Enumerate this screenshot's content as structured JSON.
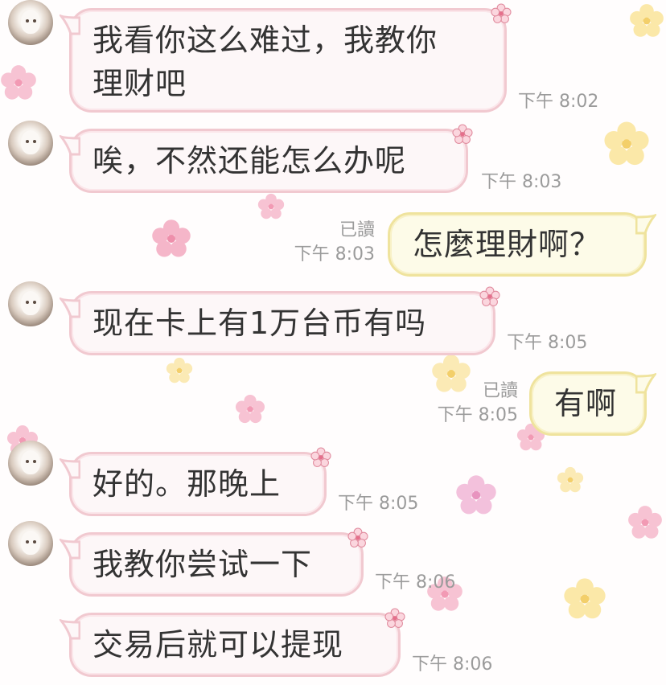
{
  "messages": [
    {
      "side": "in",
      "lines": [
        "我看你这么难过，我教你",
        "理财吧"
      ],
      "time": "下午 8:02"
    },
    {
      "side": "in",
      "lines": [
        "唉，不然还能怎么办呢"
      ],
      "time": "下午 8:03"
    },
    {
      "side": "out",
      "lines": [
        "怎麼理財啊？"
      ],
      "read": "已讀",
      "time": "下午 8:03"
    },
    {
      "side": "in",
      "lines": [
        "现在卡上有1万台币有吗"
      ],
      "time": "下午 8:05"
    },
    {
      "side": "out",
      "lines": [
        "有啊"
      ],
      "read": "已讀",
      "time": "下午 8:05"
    },
    {
      "side": "in",
      "lines": [
        "好的。那晚上"
      ],
      "time": "下午 8:05"
    },
    {
      "side": "in",
      "lines": [
        "我教你尝试一下"
      ],
      "time": "下午 8:06"
    },
    {
      "side": "in",
      "lines": [
        "交易后就可以提现"
      ],
      "time": "下午 8:06"
    }
  ],
  "icons": {
    "avatar": "cat-avatar-icon",
    "bubble_corner": "sakura-flower-icon"
  },
  "colors": {
    "incoming_border": "#f1c9d0",
    "outgoing_border": "#efe39d",
    "text": "#333333",
    "meta": "#9b9b9b"
  }
}
